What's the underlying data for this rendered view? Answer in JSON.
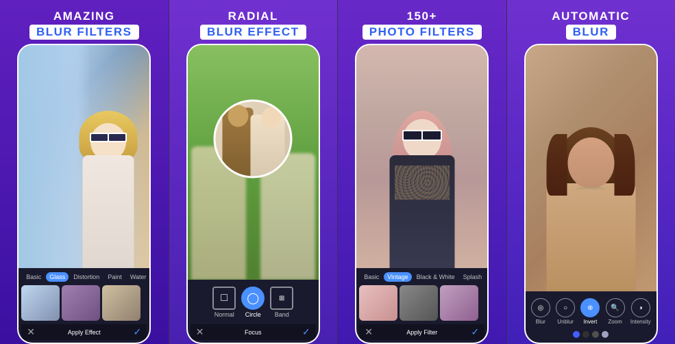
{
  "panels": [
    {
      "id": "panel-1",
      "title_line1": "AMAZING",
      "title_line2": "BLUR FILTERS",
      "filter_tabs": [
        "Basic",
        "Glass",
        "Distortion",
        "Paint",
        "Water"
      ],
      "active_tab": "Glass",
      "thumbnails": [
        "thumb1",
        "thumb2",
        "thumb3"
      ],
      "action_label": "Apply Effect"
    },
    {
      "id": "panel-2",
      "title_line1": "RADIAL",
      "title_line2": "BLUR EFFECT",
      "shapes": [
        "Normal",
        "Circle",
        "Band"
      ],
      "active_shape": "Circle",
      "bottom_label": "Focus"
    },
    {
      "id": "panel-3",
      "title_line1": "150+",
      "title_line2": "PHOTO FILTERS",
      "filter_tabs": [
        "Basic",
        "Vintage",
        "Black & White",
        "Splash"
      ],
      "active_tab": "Vintage",
      "thumbnails": [
        "thumb1",
        "thumb2",
        "thumb3"
      ],
      "action_label": "Apply Filter"
    },
    {
      "id": "panel-4",
      "title_line1": "AUTOMATIC",
      "title_line2": "BLUR",
      "tools": [
        "Blur",
        "Unblur",
        "Invert",
        "Zoom",
        "Intensity"
      ],
      "active_tool": "Invert",
      "color_dots": [
        "#4060ff",
        "#303030",
        "#505050",
        "#a0a0c0"
      ]
    }
  ]
}
